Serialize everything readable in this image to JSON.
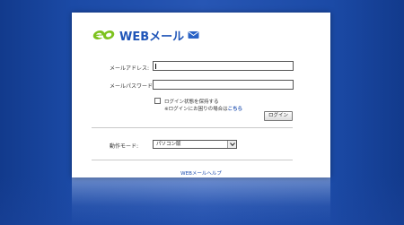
{
  "logo": {
    "brand": "eo",
    "service": "WEBメール"
  },
  "login": {
    "address_label": "メールアドレス:",
    "password_label": "メールパスワード:",
    "address_value": "",
    "password_value": "",
    "keep_login_label": "ログイン状態を保持する",
    "trouble_prefix": "※ログインにお困りの場合は",
    "trouble_link": "こちら",
    "login_button": "ログイン"
  },
  "mode": {
    "label": "動作モード:",
    "selected": "パソコン版"
  },
  "footer": {
    "help_link": "WEBメールヘルプ"
  },
  "colors": {
    "background": "#2756b4",
    "card": "#ffffff",
    "logo_green": "#7dc21e",
    "logo_blue": "#1f55b8",
    "link": "#1f4fb0"
  }
}
